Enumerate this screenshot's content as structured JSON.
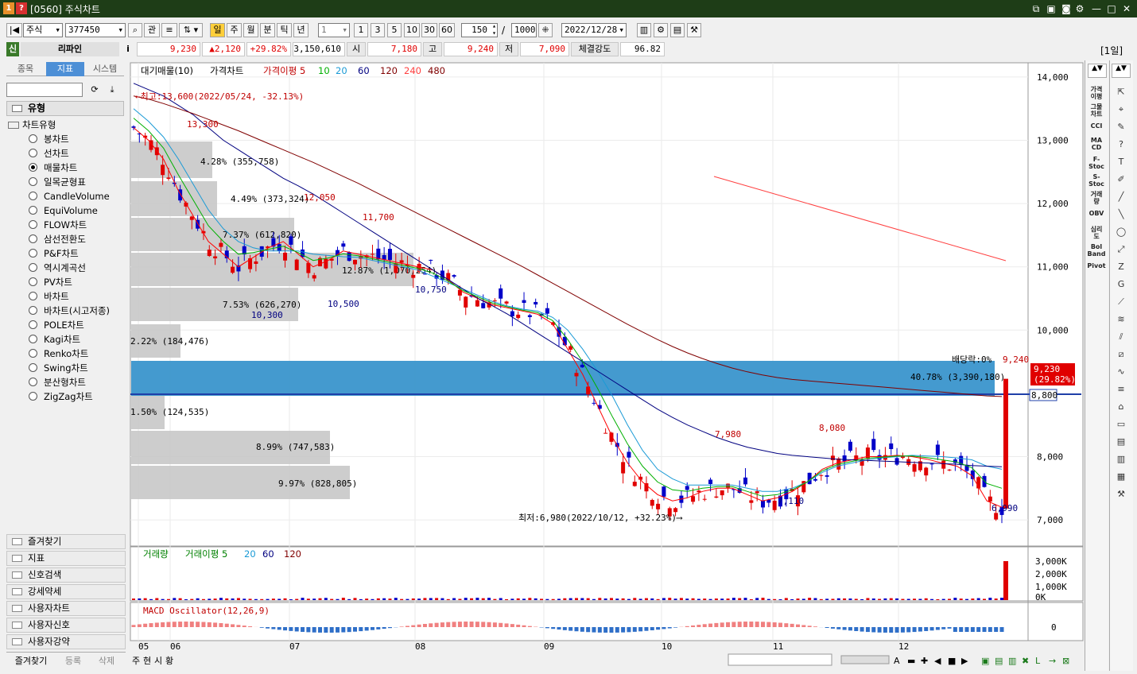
{
  "window": {
    "title": "[0560] 주식차트",
    "icon1": "1",
    "icon2": "?"
  },
  "toolbar": {
    "market": "주식",
    "code": "377450",
    "btn_kwan": "관",
    "periods": [
      "일",
      "주",
      "월",
      "분",
      "틱",
      "년"
    ],
    "interval_value": "1",
    "interval_btns": [
      "1",
      "3",
      "5",
      "10",
      "30",
      "60"
    ],
    "count": "150",
    "sep": "/",
    "total": "1000",
    "date": "2022/12/28"
  },
  "quote": {
    "badge": "신",
    "name": "리파인",
    "info_icon": "i",
    "price": "9,230",
    "change": "▲2,120",
    "pct": "+29.82%",
    "volume": "3,150,610",
    "open_lbl": "시",
    "open": "7,180",
    "high_lbl": "고",
    "high": "9,240",
    "low_lbl": "저",
    "low": "7,090",
    "str_lbl": "체결강도",
    "str": "96.82",
    "period_tag": "[1일]"
  },
  "left": {
    "tabs": [
      "종목",
      "지표",
      "시스템"
    ],
    "category": "유형",
    "tree_root": "차트유형",
    "types": [
      "봉차트",
      "선차트",
      "매물차트",
      "일목균형표",
      "CandleVolume",
      "EquiVolume",
      "FLOW차트",
      "삼선전환도",
      "P&F차트",
      "역시계곡선",
      "PV차트",
      "바차트",
      "바차트(시고저종)",
      "POLE차트",
      "Kagi차트",
      "Renko차트",
      "Swing차트",
      "분산형차트",
      "ZigZag차트"
    ],
    "selected": 2,
    "sections": [
      "즐겨찾기",
      "지표",
      "신호검색",
      "강세약세",
      "사용자차트",
      "사용자신호",
      "사용자강약"
    ],
    "bottom_tabs": [
      "즐겨찾기",
      "등록",
      "삭제"
    ]
  },
  "legend": {
    "vp": "대기매물(10)",
    "price": "가격차트",
    "ma": "가격이평 5",
    "ma_periods": [
      "10",
      "20",
      "60",
      "120",
      "240",
      "480"
    ],
    "ma_colors": [
      "#ff0000",
      "#00b000",
      "#1a9ad6",
      "#000080",
      "#800000",
      "#ff4040",
      "#800000"
    ]
  },
  "annot": {
    "high": "←최고:13,600(2022/05/24, -32.13%)",
    "low": "최저:6,980(2022/10/12, +32.23%)⟶",
    "div": "배당락:0%",
    "div_price": "9,240",
    "marks": [
      "13,300",
      "12,050",
      "11,700",
      "10,750",
      "10,500",
      "10,300",
      "7,980",
      "8,080",
      "7,110",
      "6,990"
    ],
    "vp_labels": [
      "4.28% (355,758)",
      "4.49% (373,324)",
      "7.37% (612,820)",
      "12.87% (1,070,254)",
      "7.53% (626,270)",
      "2.22% (184,476)",
      "40.78% (3,390,180)",
      "1.50% (124,535)",
      "8.99% (747,583)",
      "9.97% (828,805)"
    ]
  },
  "axis": {
    "price_ticks": [
      "14,000",
      "13,000",
      "12,000",
      "11,000",
      "10,000",
      "8,000",
      "7,000"
    ],
    "current_price": "9,230",
    "current_pct": "(29.82%)",
    "line_price": "8,800",
    "vol_ticks": [
      "3,000K",
      "2,000K",
      "1,000K",
      "0K"
    ],
    "macd_ticks": [
      "0"
    ],
    "months": [
      "05",
      "06",
      "07",
      "08",
      "09",
      "10",
      "11",
      "12"
    ]
  },
  "volume_panel": {
    "legend": "거래량",
    "ma": "거래이평 5",
    "periods": [
      "20",
      "60",
      "120"
    ]
  },
  "macd_panel": {
    "legend": "MACD Oscillator(12,26,9)"
  },
  "chart_data": {
    "type": "candlestick",
    "ylim": [
      6700,
      14300
    ],
    "ma_lines": [
      {
        "name": "5",
        "color": "#ff0000",
        "values": [
          13200,
          13000,
          12700,
          12200,
          11800,
          11400,
          11200,
          11000,
          11150,
          11300,
          11400,
          11200,
          11000,
          11100,
          11250,
          11200,
          11150,
          11100,
          11050,
          11000,
          10950,
          10800,
          10600,
          10500,
          10400,
          10350,
          10300,
          10250,
          10100,
          9700,
          9300,
          8800,
          8300,
          7900,
          7600,
          7400,
          7300,
          7350,
          7450,
          7500,
          7500,
          7400,
          7300,
          7350,
          7450,
          7600,
          7800,
          7900,
          7950,
          8000,
          8000,
          8020,
          8000,
          7960,
          7900,
          7850,
          7700,
          7300,
          7200
        ]
      },
      {
        "name": "20",
        "color": "#1a9ad6",
        "values": [
          13500,
          13300,
          13050,
          12700,
          12300,
          11900,
          11600,
          11400,
          11300,
          11250,
          11250,
          11250,
          11200,
          11180,
          11160,
          11150,
          11100,
          11050,
          11000,
          10950,
          10850,
          10750,
          10650,
          10550,
          10450,
          10380,
          10330,
          10300,
          10200,
          10000,
          9700,
          9350,
          8950,
          8500,
          8100,
          7800,
          7650,
          7550,
          7550,
          7550,
          7550,
          7500,
          7450,
          7450,
          7500,
          7600,
          7750,
          7850,
          7900,
          7950,
          7980,
          8000,
          8020,
          8010,
          8000,
          7980,
          7950,
          7850,
          7800
        ]
      },
      {
        "name": "60",
        "color": "#000080",
        "values": [
          13900,
          13800,
          13700,
          13550,
          13400,
          13200,
          13000,
          12850,
          12700,
          12550,
          12400,
          12280,
          12150,
          12000,
          11850,
          11700,
          11550,
          11400,
          11250,
          11100,
          10950,
          10800,
          10650,
          10500,
          10380,
          10250,
          10100,
          9950,
          9800,
          9650,
          9500,
          9350,
          9200,
          9050,
          8900,
          8750,
          8620,
          8500,
          8400,
          8300,
          8220,
          8150,
          8100,
          8050,
          8020,
          8000,
          7980,
          7960,
          7950,
          7940,
          7930,
          7920,
          7910,
          7900,
          7890,
          7880,
          7860,
          7850,
          7840
        ]
      },
      {
        "name": "120",
        "color": "#800000",
        "values": [
          13700,
          13650,
          13580,
          13500,
          13420,
          13330,
          13240,
          13150,
          13050,
          12950,
          12850,
          12750,
          12650,
          12540,
          12430,
          12320,
          12200,
          12080,
          11960,
          11840,
          11720,
          11600,
          11480,
          11360,
          11240,
          11120,
          11000,
          10870,
          10740,
          10610,
          10480,
          10350,
          10220,
          10090,
          9970,
          9850,
          9740,
          9640,
          9550,
          9470,
          9400,
          9340,
          9290,
          9250,
          9220,
          9200,
          9180,
          9160,
          9140,
          9120,
          9100,
          9080,
          9060,
          9040,
          9020,
          9000,
          8980,
          8960,
          8950
        ]
      }
    ]
  }
}
